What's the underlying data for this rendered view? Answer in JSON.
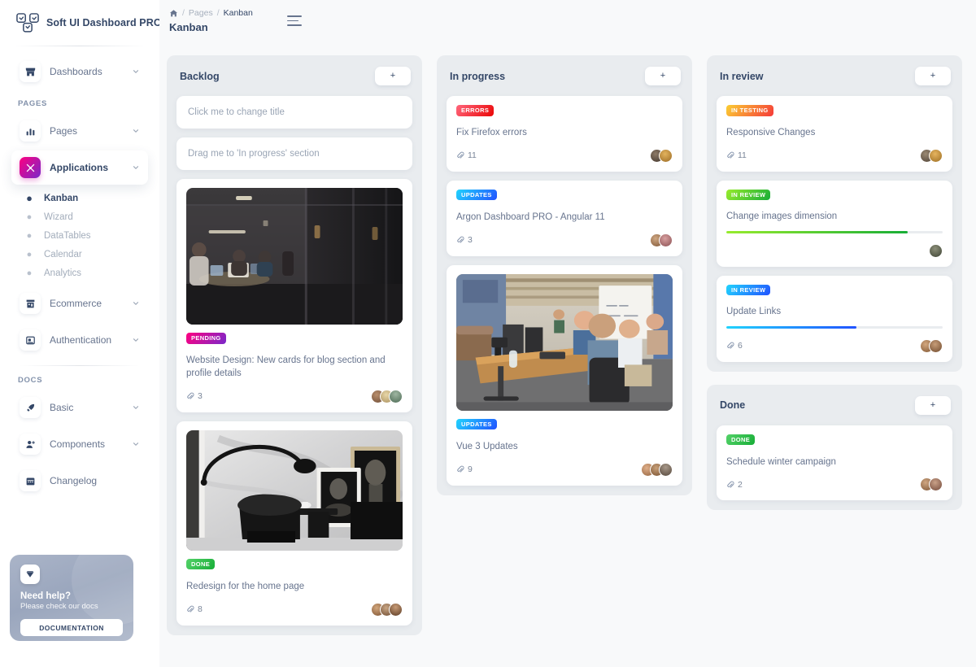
{
  "brand": {
    "name": "Soft UI Dashboard PRO",
    "logo_icon": "soft-ui-logo-icon"
  },
  "sidebar": {
    "top_items": [
      {
        "label": "Dashboards",
        "icon": "shop-icon",
        "chevron": "chevron-down-icon"
      }
    ],
    "sections": [
      {
        "title": "PAGES",
        "items": [
          {
            "label": "Pages",
            "icon": "chart-bar-icon",
            "chevron": "chevron-down-icon",
            "active": false
          },
          {
            "label": "Applications",
            "icon": "tools-icon",
            "chevron": "chevron-down-icon",
            "active": true,
            "children": [
              {
                "label": "Kanban",
                "active": true
              },
              {
                "label": "Wizard",
                "active": false
              },
              {
                "label": "DataTables",
                "active": false
              },
              {
                "label": "Calendar",
                "active": false
              },
              {
                "label": "Analytics",
                "active": false
              }
            ]
          },
          {
            "label": "Ecommerce",
            "icon": "store-icon",
            "chevron": "chevron-down-icon",
            "active": false
          },
          {
            "label": "Authentication",
            "icon": "id-card-icon",
            "chevron": "chevron-down-icon",
            "active": false
          }
        ]
      },
      {
        "title": "DOCS",
        "items": [
          {
            "label": "Basic",
            "icon": "rocket-icon",
            "chevron": "chevron-down-icon",
            "active": false
          },
          {
            "label": "Components",
            "icon": "user-plus-icon",
            "chevron": "chevron-down-icon",
            "active": false
          },
          {
            "label": "Changelog",
            "icon": "calendar-icon",
            "chevron": "",
            "active": false
          }
        ]
      }
    ],
    "help": {
      "icon": "diamond-icon",
      "title": "Need help?",
      "subtitle": "Please check our docs",
      "button_label": "DOCUMENTATION"
    }
  },
  "header": {
    "breadcrumb": {
      "home_icon": "home-icon",
      "sep": "/",
      "parent": "Pages",
      "current": "Kanban"
    },
    "title": "Kanban",
    "menu_icon": "hamburger-icon"
  },
  "board": {
    "add_label": "+",
    "columns": [
      {
        "title": "Backlog",
        "tasks": [
          {
            "type": "placeholder",
            "text": "Click me to change title"
          },
          {
            "type": "placeholder",
            "text": "Drag me to 'In progress' section"
          },
          {
            "type": "card",
            "image": "office-night-photo",
            "badge": {
              "label": "Pending",
              "style": "pending"
            },
            "title": "Website Design: New cards for blog section and profile details",
            "attachments": "3",
            "attach_icon": "paperclip-icon",
            "avatars": 3
          },
          {
            "type": "card",
            "image": "interior-lamp-photo",
            "badge": {
              "label": "Done",
              "style": "done"
            },
            "title": "Redesign for the home page",
            "attachments": "8",
            "attach_icon": "paperclip-icon",
            "avatars": 3
          }
        ]
      },
      {
        "title": "In progress",
        "tasks": [
          {
            "type": "card",
            "badge": {
              "label": "Errors",
              "style": "errors"
            },
            "title": "Fix Firefox errors",
            "attachments": "11",
            "attach_icon": "paperclip-icon",
            "avatars": 2
          },
          {
            "type": "card",
            "badge": {
              "label": "Updates",
              "style": "updates"
            },
            "title": "Argon Dashboard PRO - Angular 11",
            "attachments": "3",
            "attach_icon": "paperclip-icon",
            "avatars": 2
          },
          {
            "type": "card",
            "image": "office-meeting-photo",
            "badge": {
              "label": "Updates",
              "style": "updates"
            },
            "title": "Vue 3 Updates",
            "attachments": "9",
            "attach_icon": "paperclip-icon",
            "avatars": 3
          }
        ]
      },
      {
        "title": "In review",
        "tasks": [
          {
            "type": "card",
            "badge": {
              "label": "In testing",
              "style": "testing"
            },
            "title": "Responsive Changes",
            "attachments": "11",
            "attach_icon": "paperclip-icon",
            "avatars": 2
          },
          {
            "type": "card",
            "badge": {
              "label": "In review",
              "style": "review"
            },
            "title": "Change images dimension",
            "progress": {
              "percent": 84,
              "color": "green"
            },
            "avatars": 1
          },
          {
            "type": "card",
            "badge": {
              "label": "In review",
              "style": "review"
            },
            "title": "Update Links",
            "progress": {
              "percent": 60,
              "color": "blue"
            },
            "attachments": "6",
            "attach_icon": "paperclip-icon",
            "avatars": 2
          }
        ]
      },
      {
        "title": "Done",
        "tasks": [
          {
            "type": "card",
            "badge": {
              "label": "Done",
              "style": "done"
            },
            "title": "Schedule winter campaign",
            "attachments": "2",
            "attach_icon": "paperclip-icon",
            "avatars": 2
          }
        ]
      }
    ]
  },
  "colors": {
    "accent": "#cb0c9f",
    "text_dark": "#344767",
    "text_muted": "#67748e",
    "pane": "#e9ecef",
    "page_bg": "#f8f9fa"
  }
}
